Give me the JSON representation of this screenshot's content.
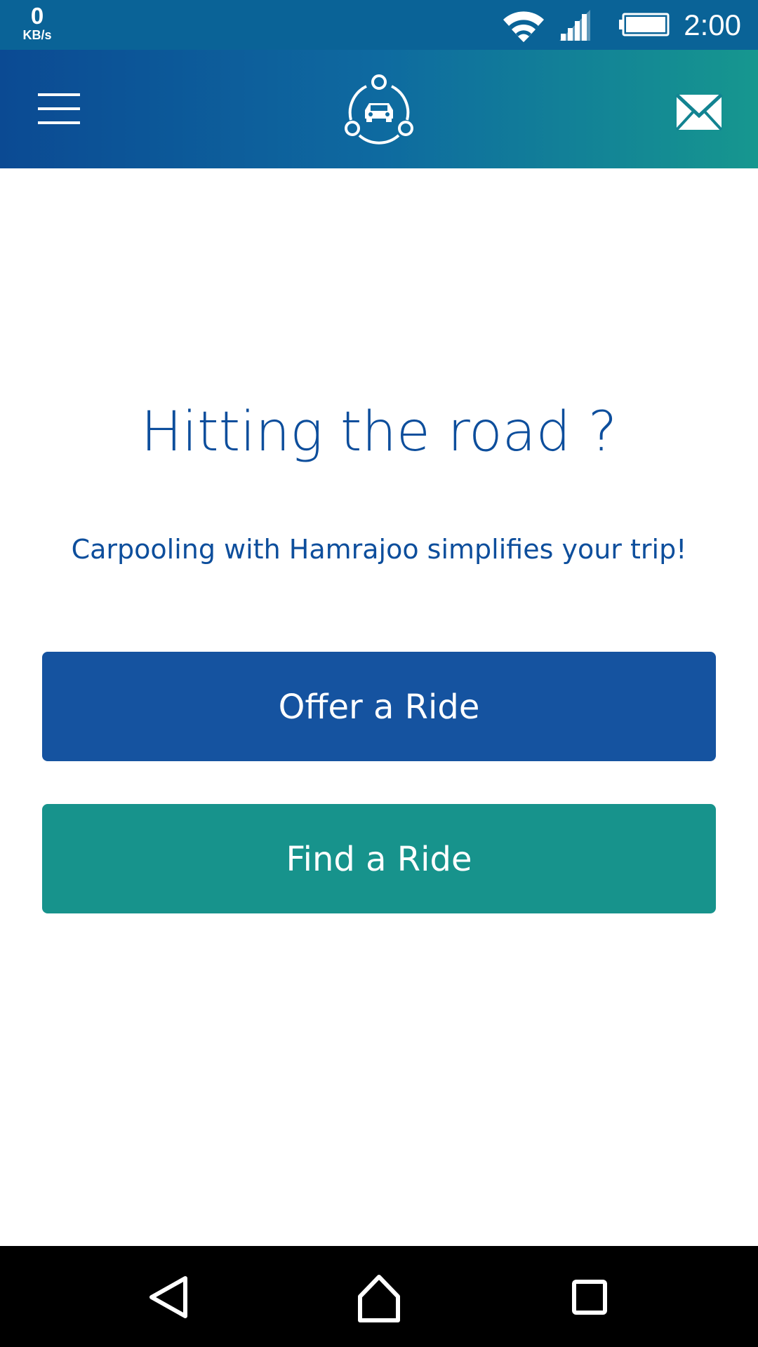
{
  "status_bar": {
    "net_speed_value": "0",
    "net_speed_unit": "KB/s",
    "time": "2:00",
    "icons": [
      "wifi-icon",
      "signal-icon",
      "battery-icon"
    ]
  },
  "app_bar": {
    "menu_icon": "hamburger-menu-icon",
    "logo_icon": "carpool-logo-icon",
    "mail_icon": "mail-icon",
    "gradient_start": "#0b4a93",
    "gradient_end": "#16978f"
  },
  "main": {
    "headline": "Hitting the road ?",
    "subtitle": "Carpooling with Hamrajoo simplifies your trip!",
    "offer_button_label": "Offer a Ride",
    "find_button_label": "Find a Ride",
    "offer_button_color": "#1553a0",
    "find_button_color": "#17938c",
    "text_color": "#0d4e9c"
  },
  "nav_bar": {
    "icons": [
      "back-icon",
      "home-icon",
      "recents-icon"
    ]
  }
}
